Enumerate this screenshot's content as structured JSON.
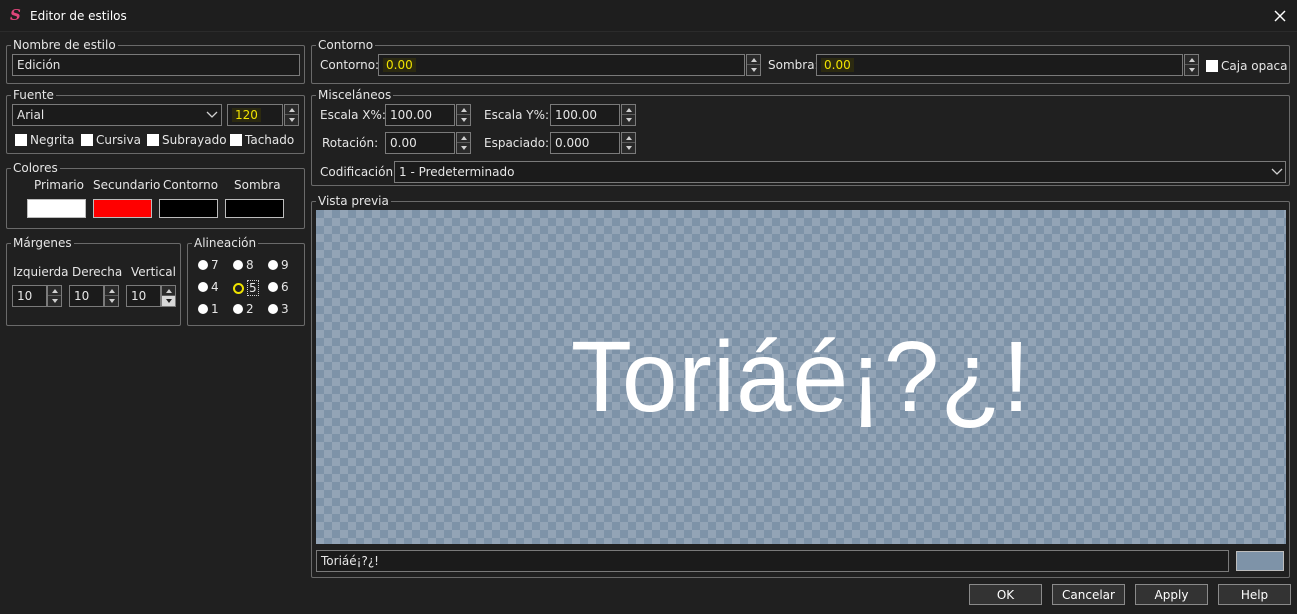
{
  "window": {
    "title": "Editor de estilos",
    "app_icon_letter": "S",
    "close_icon": "close-icon"
  },
  "style_name": {
    "legend": "Nombre de estilo",
    "value": "Edición"
  },
  "font": {
    "legend": "Fuente",
    "family": "Arial",
    "size": "120",
    "bold": "Negrita",
    "italic": "Cursiva",
    "underline": "Subrayado",
    "strikeout": "Tachado"
  },
  "colors": {
    "legend": "Colores",
    "primary": {
      "label": "Primario",
      "color": "#ffffff"
    },
    "secondary": {
      "label": "Secundario",
      "color": "#ff0000"
    },
    "outline": {
      "label": "Contorno",
      "color": "#000000"
    },
    "shadow": {
      "label": "Sombra",
      "color": "#000000"
    }
  },
  "margins": {
    "legend": "Márgenes",
    "left_label": "Izquierda",
    "left": "10",
    "right_label": "Derecha",
    "right": "10",
    "vertical_label": "Vertical",
    "vertical": "10"
  },
  "alignment": {
    "legend": "Alineación",
    "options": [
      "7",
      "8",
      "9",
      "4",
      "5",
      "6",
      "1",
      "2",
      "3"
    ],
    "selected": "5"
  },
  "outline": {
    "legend": "Contorno",
    "outline_label": "Contorno:",
    "outline_value": "0.00",
    "shadow_label": "Sombra:",
    "shadow_value": "0.00",
    "opaque_box": "Caja opaca"
  },
  "misc": {
    "legend": "Misceláneos",
    "scale_x_label": "Escala X%:",
    "scale_x": "100.00",
    "scale_y_label": "Escala Y%:",
    "scale_y": "100.00",
    "rotation_label": "Rotación:",
    "rotation": "0.00",
    "spacing_label": "Espaciado:",
    "spacing": "0.000",
    "encoding_label": "Codificación:",
    "encoding": "1 - Predeterminado"
  },
  "preview": {
    "legend": "Vista previa",
    "text": "Toriáé¡?¿!",
    "input_text": "Toriáé¡?¿!",
    "bg_color": "#7e93a8"
  },
  "buttons": {
    "ok": "OK",
    "cancel": "Cancelar",
    "apply": "Apply",
    "help": "Help"
  }
}
